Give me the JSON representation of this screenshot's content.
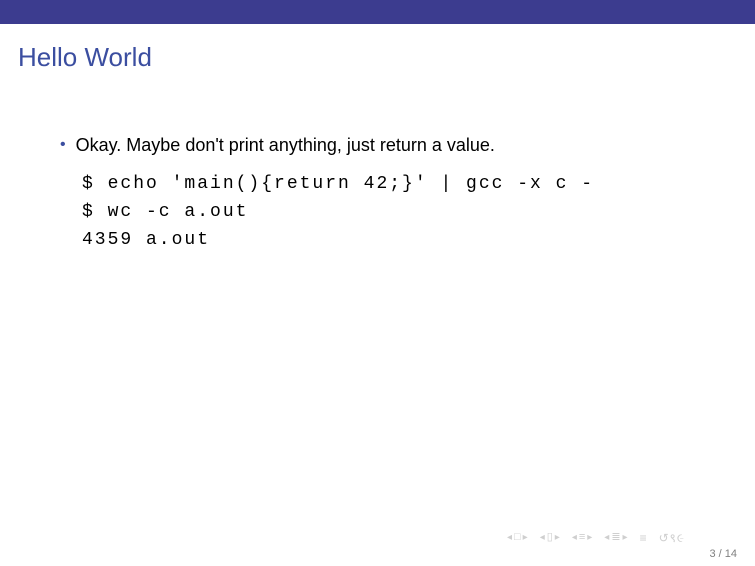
{
  "title": "Hello World",
  "bullet": {
    "marker": "•",
    "text": "Okay.  Maybe don't print anything, just return a value."
  },
  "code": "$ echo 'main(){return 42;}' | gcc -x c -\n$ wc -c a.out\n4359 a.out",
  "nav": {
    "prev": "◂",
    "next": "▸",
    "square": "□",
    "doc": "▯",
    "eq1": "≡",
    "eq2": "≣",
    "mode": "≡",
    "refresh": "↺९૯"
  },
  "page": "3 / 14"
}
